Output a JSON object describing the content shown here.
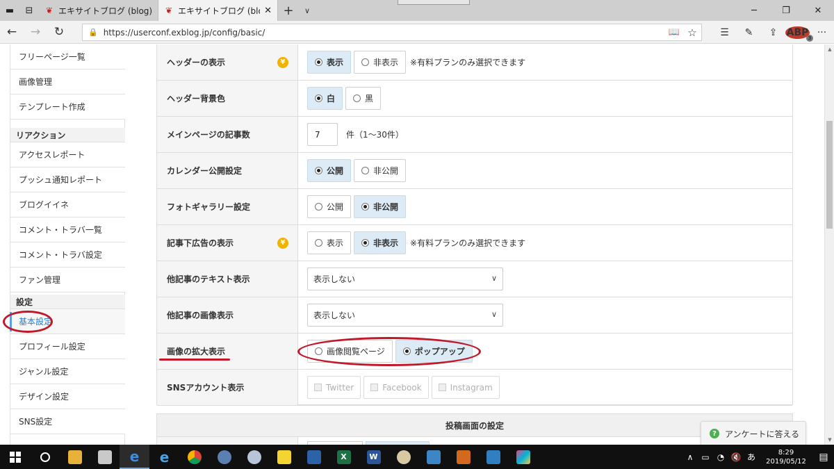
{
  "browser": {
    "tabs": [
      {
        "title": "エキサイトブログ (blog)|記事編"
      },
      {
        "title": "エキサイトブログ (blog)|基本"
      }
    ],
    "url": "https://userconf.exblog.jp/config/basic/",
    "adblock_count": "3"
  },
  "sidebar": {
    "items": [
      {
        "type": "item",
        "label": "フリーページ一覧"
      },
      {
        "type": "item",
        "label": "画像管理"
      },
      {
        "type": "item",
        "label": "テンプレート作成"
      },
      {
        "type": "section",
        "label": "リアクション"
      },
      {
        "type": "item",
        "label": "アクセスレポート"
      },
      {
        "type": "item",
        "label": "プッシュ通知レポート"
      },
      {
        "type": "item",
        "label": "ブログイイネ"
      },
      {
        "type": "item",
        "label": "コメント・トラバ一覧"
      },
      {
        "type": "item",
        "label": "コメント・トラバ設定"
      },
      {
        "type": "item",
        "label": "ファン管理"
      },
      {
        "type": "section",
        "label": "設定"
      },
      {
        "type": "item",
        "label": "基本設定",
        "current": true
      },
      {
        "type": "item",
        "label": "プロフィール設定"
      },
      {
        "type": "item",
        "label": "ジャンル設定"
      },
      {
        "type": "item",
        "label": "デザイン設定"
      },
      {
        "type": "item",
        "label": "SNS設定"
      }
    ]
  },
  "settings": {
    "header_display": {
      "label": "ヘッダーの表示",
      "premium_icon": "yen-icon",
      "options": [
        "表示",
        "非表示"
      ],
      "selected": 0,
      "note": "※有料プランのみ選択できます"
    },
    "header_bg": {
      "label": "ヘッダー背景色",
      "options": [
        "白",
        "黒"
      ],
      "selected": 0
    },
    "main_count": {
      "label": "メインページの記事数",
      "value": "7",
      "unit": "件（1〜30件）"
    },
    "calendar": {
      "label": "カレンダー公開設定",
      "options": [
        "公開",
        "非公開"
      ],
      "selected": 0
    },
    "photo_gallery": {
      "label": "フォトギャラリー設定",
      "options": [
        "公開",
        "非公開"
      ],
      "selected": 1
    },
    "below_ad": {
      "label": "記事下広告の表示",
      "premium_icon": "yen-icon",
      "options": [
        "表示",
        "非表示"
      ],
      "selected": 1,
      "note": "※有料プランのみ選択できます"
    },
    "other_text": {
      "label": "他記事のテキスト表示",
      "value": "表示しない"
    },
    "other_image": {
      "label": "他記事の画像表示",
      "value": "表示しない"
    },
    "image_zoom": {
      "label": "画像の拡大表示",
      "options": [
        "画像閲覧ページ",
        "ポップアップ"
      ],
      "selected": 1
    },
    "sns_accounts": {
      "label": "SNSアカウント表示",
      "options": [
        "Twitter",
        "Facebook",
        "Instagram"
      ]
    }
  },
  "post_section_title": "投稿画面の設定",
  "survey_button": "アンケートに答える",
  "taskbar": {
    "time": "8:29",
    "date": "2019/05/12",
    "ime": "あ"
  },
  "colors": {
    "selected_bg": "#dcebf6",
    "annotation_red": "#c0192a",
    "sidebar_current": "#2b7ec6"
  }
}
